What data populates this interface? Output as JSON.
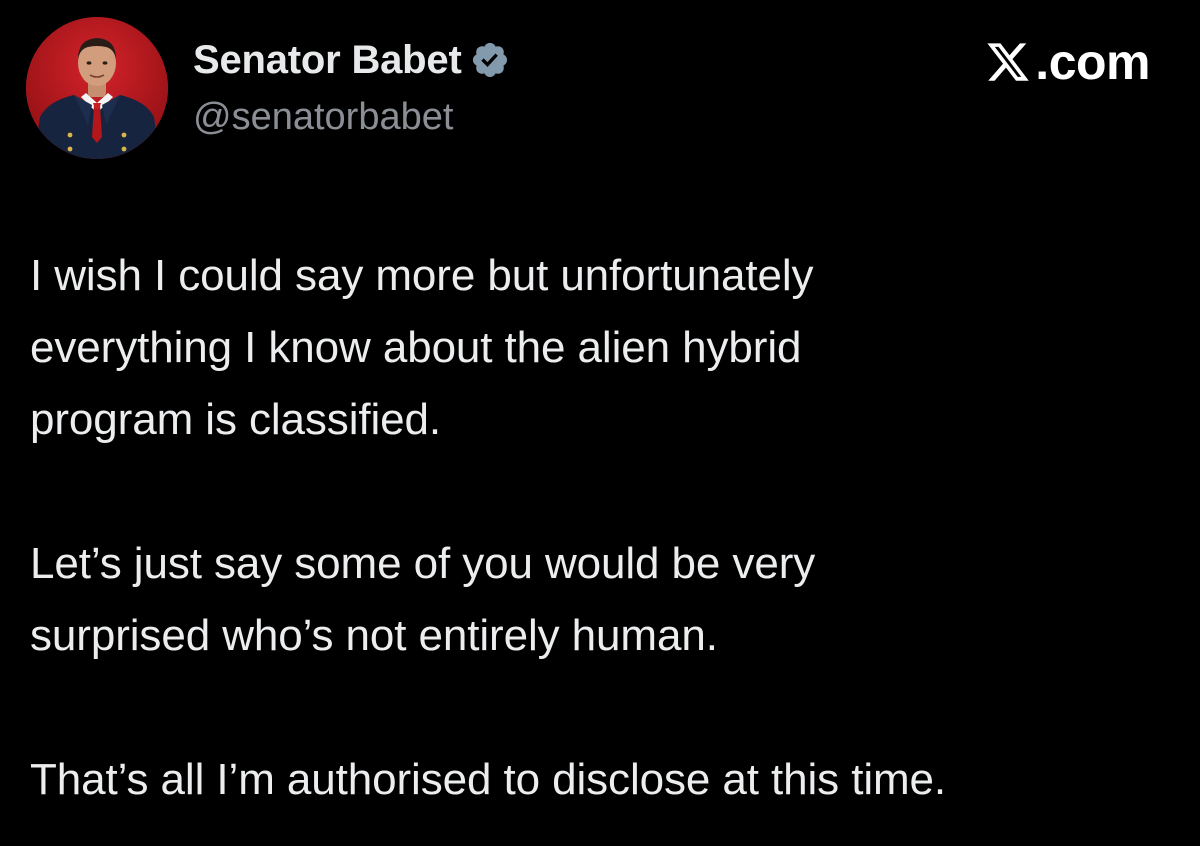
{
  "author": {
    "display_name": "Senator Babet",
    "handle": "@senatorbabet",
    "verified": true,
    "avatar_icon": "senator-portrait-avatar"
  },
  "watermark": {
    "logo_icon": "x-logo-icon",
    "text": ".com"
  },
  "tweet": {
    "paragraphs": [
      "I wish I could say more but unfortunately\neverything I know about the alien hybrid\nprogram is classified.",
      "Let’s just say some of you would be very\nsurprised who’s not entirely human.",
      "That’s all I’m authorised to disclose at this time."
    ]
  },
  "colors": {
    "background": "#000000",
    "text_primary": "#e7e9ea",
    "text_secondary": "#8b8f95",
    "verified_badge": "#829aab",
    "avatar_background": "#b3161b"
  }
}
